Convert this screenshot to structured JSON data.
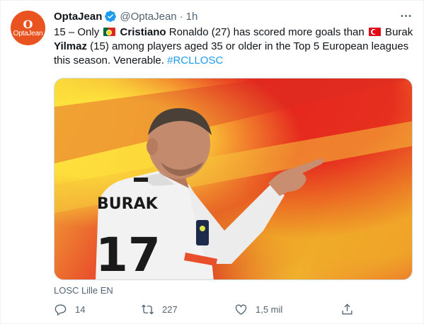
{
  "author": {
    "display_name": "OptaJean",
    "handle": "@OptaJean",
    "time": "1h",
    "avatar_mark": "O",
    "avatar_brand": "OptaJean"
  },
  "tweet": {
    "segments": [
      {
        "text": "15 – Only "
      },
      {
        "flag": "pt"
      },
      {
        "text": " Cristiano",
        "bold": true
      },
      {
        "text": " Ronaldo (27) has scored more goals than "
      },
      {
        "flag": "tr"
      },
      {
        "text": " Burak "
      },
      {
        "text": "Yilmaz",
        "bold": true
      },
      {
        "text": " (15) among players aged 35 or older in the Top 5 European leagues this season. Venerable. "
      },
      {
        "text": "#RCLLOSC",
        "hashtag": true
      }
    ]
  },
  "media": {
    "jersey_name": "BURAK",
    "jersey_number": "17"
  },
  "source": "LOSC Lille EN",
  "stats": {
    "replies": "14",
    "retweets": "227",
    "likes": "1,5 mil"
  },
  "colors": {
    "accent": "#1d9bf0",
    "secondary_text": "#536471",
    "avatar_bg": "#e9531f"
  },
  "icons": [
    "verified-icon",
    "more-icon",
    "reply-icon",
    "retweet-icon",
    "like-icon",
    "share-icon"
  ]
}
